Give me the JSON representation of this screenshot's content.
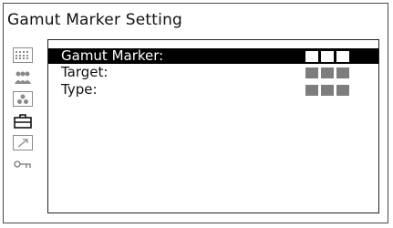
{
  "screen": {
    "title": "Gamut Marker Setting"
  },
  "sidebar": {
    "icons": [
      {
        "name": "grid-icon"
      },
      {
        "name": "users-icon"
      },
      {
        "name": "color-dots-icon"
      },
      {
        "name": "toolbox-icon",
        "active": true
      },
      {
        "name": "export-arrow-icon"
      },
      {
        "name": "key-icon"
      }
    ]
  },
  "menu": {
    "items": [
      {
        "label": "Gamut Marker:",
        "value": "■■■",
        "selected": true
      },
      {
        "label": "Target:",
        "value": "■■■",
        "selected": false
      },
      {
        "label": "Type:",
        "value": "■■■",
        "selected": false
      }
    ]
  },
  "colors": {
    "highlight": "#000000",
    "value_block": "#7d7d7d",
    "selected_value_block": "#ffffff"
  }
}
